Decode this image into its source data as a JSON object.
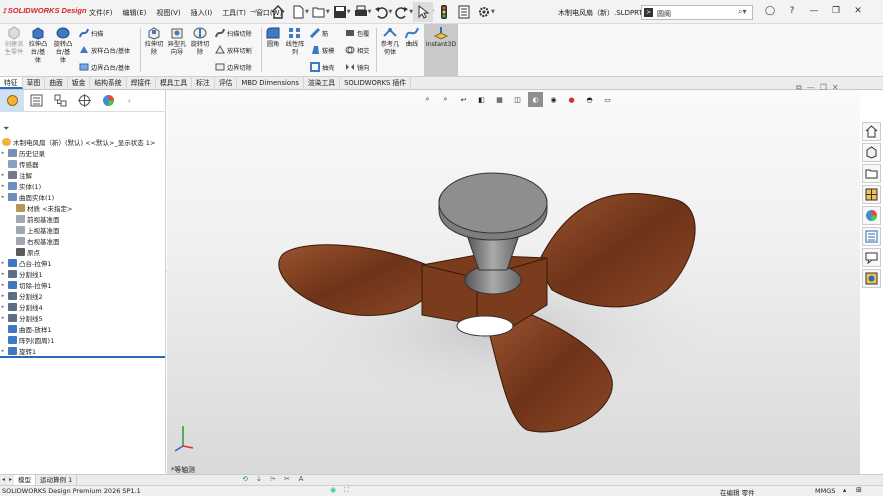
{
  "app": {
    "brand": "SOLIDWORKS Design",
    "document_title": "木制电风扇（新）.SLDPRT",
    "search_placeholder": "圆阁"
  },
  "menus": [
    "文件(F)",
    "编辑(E)",
    "视图(V)",
    "插入(I)",
    "工具(T)",
    "窗口(W)"
  ],
  "ribbon": {
    "big": [
      {
        "label": "创建派\n生零件",
        "disabled": true
      },
      {
        "label": "拉伸凸\n台/基\n体"
      },
      {
        "label": "旋转凸\n台/基\n体"
      },
      {
        "label": "拉伸切\n除"
      },
      {
        "label": "异型孔\n向导"
      },
      {
        "label": "旋转切\n除"
      },
      {
        "label": "圆角"
      },
      {
        "label": "线性阵\n列"
      },
      {
        "label": "参考几\n何体"
      },
      {
        "label": "曲线"
      },
      {
        "label": "Instant3D"
      }
    ],
    "small": {
      "sweep": "扫描",
      "loft": "放样凸台/基体",
      "boundary": "边界凸台/基体",
      "sweep_cut": "扫描切除",
      "loft_cut": "放样切割",
      "boundary_cut": "边界切除",
      "rib": "筋",
      "draft": "拔模",
      "shell": "抽壳",
      "wrap": "包覆",
      "intersect": "相交",
      "mirror": "镜向"
    }
  },
  "tabs": [
    "特征",
    "草图",
    "曲面",
    "钣金",
    "结构系统",
    "焊接件",
    "模具工具",
    "标注",
    "评估",
    "MBD Dimensions",
    "渲染工具",
    "SOLIDWORKS 插件"
  ],
  "active_tab": 0,
  "tree": {
    "root": "木制电风扇（新）(默认) <<默认>_显示状态 1>",
    "items": [
      {
        "label": "历史记录",
        "arrow": true,
        "sub": false
      },
      {
        "label": "传感器",
        "arrow": false,
        "sub": false
      },
      {
        "label": "注解",
        "arrow": true,
        "sub": false
      },
      {
        "label": "实体(1)",
        "arrow": true,
        "sub": false
      },
      {
        "label": "曲面实体(1)",
        "arrow": true,
        "sub": false
      },
      {
        "label": "材质 <未指定>",
        "arrow": false,
        "sub": true
      },
      {
        "label": "前视基准面",
        "arrow": false,
        "sub": true
      },
      {
        "label": "上视基准面",
        "arrow": false,
        "sub": true
      },
      {
        "label": "右视基准面",
        "arrow": false,
        "sub": true
      },
      {
        "label": "原点",
        "arrow": false,
        "sub": true
      },
      {
        "label": "凸台-拉伸1",
        "arrow": true,
        "sub": false
      },
      {
        "label": "分割线1",
        "arrow": true,
        "sub": false
      },
      {
        "label": "切除-拉伸1",
        "arrow": true,
        "sub": false
      },
      {
        "label": "分割线2",
        "arrow": true,
        "sub": false
      },
      {
        "label": "分割线4",
        "arrow": true,
        "sub": false
      },
      {
        "label": "分割线5",
        "arrow": true,
        "sub": false
      },
      {
        "label": "曲面-放样1",
        "arrow": false,
        "sub": false
      },
      {
        "label": "阵列(圆周)1",
        "arrow": false,
        "sub": false
      },
      {
        "label": "旋转1",
        "arrow": true,
        "sub": false
      }
    ]
  },
  "viewport": {
    "view_label": "*等轴测"
  },
  "model_tabs": [
    "模型",
    "运动算例 1"
  ],
  "status": {
    "left": "SOLIDWORKS Design Premium 2026 SP1.1",
    "mode": "在编辑 零件",
    "units": "MMGS"
  },
  "colors": {
    "accent": "#2a6ab9",
    "wood": "#7a3c1c",
    "hub": "#8a8a8a"
  }
}
